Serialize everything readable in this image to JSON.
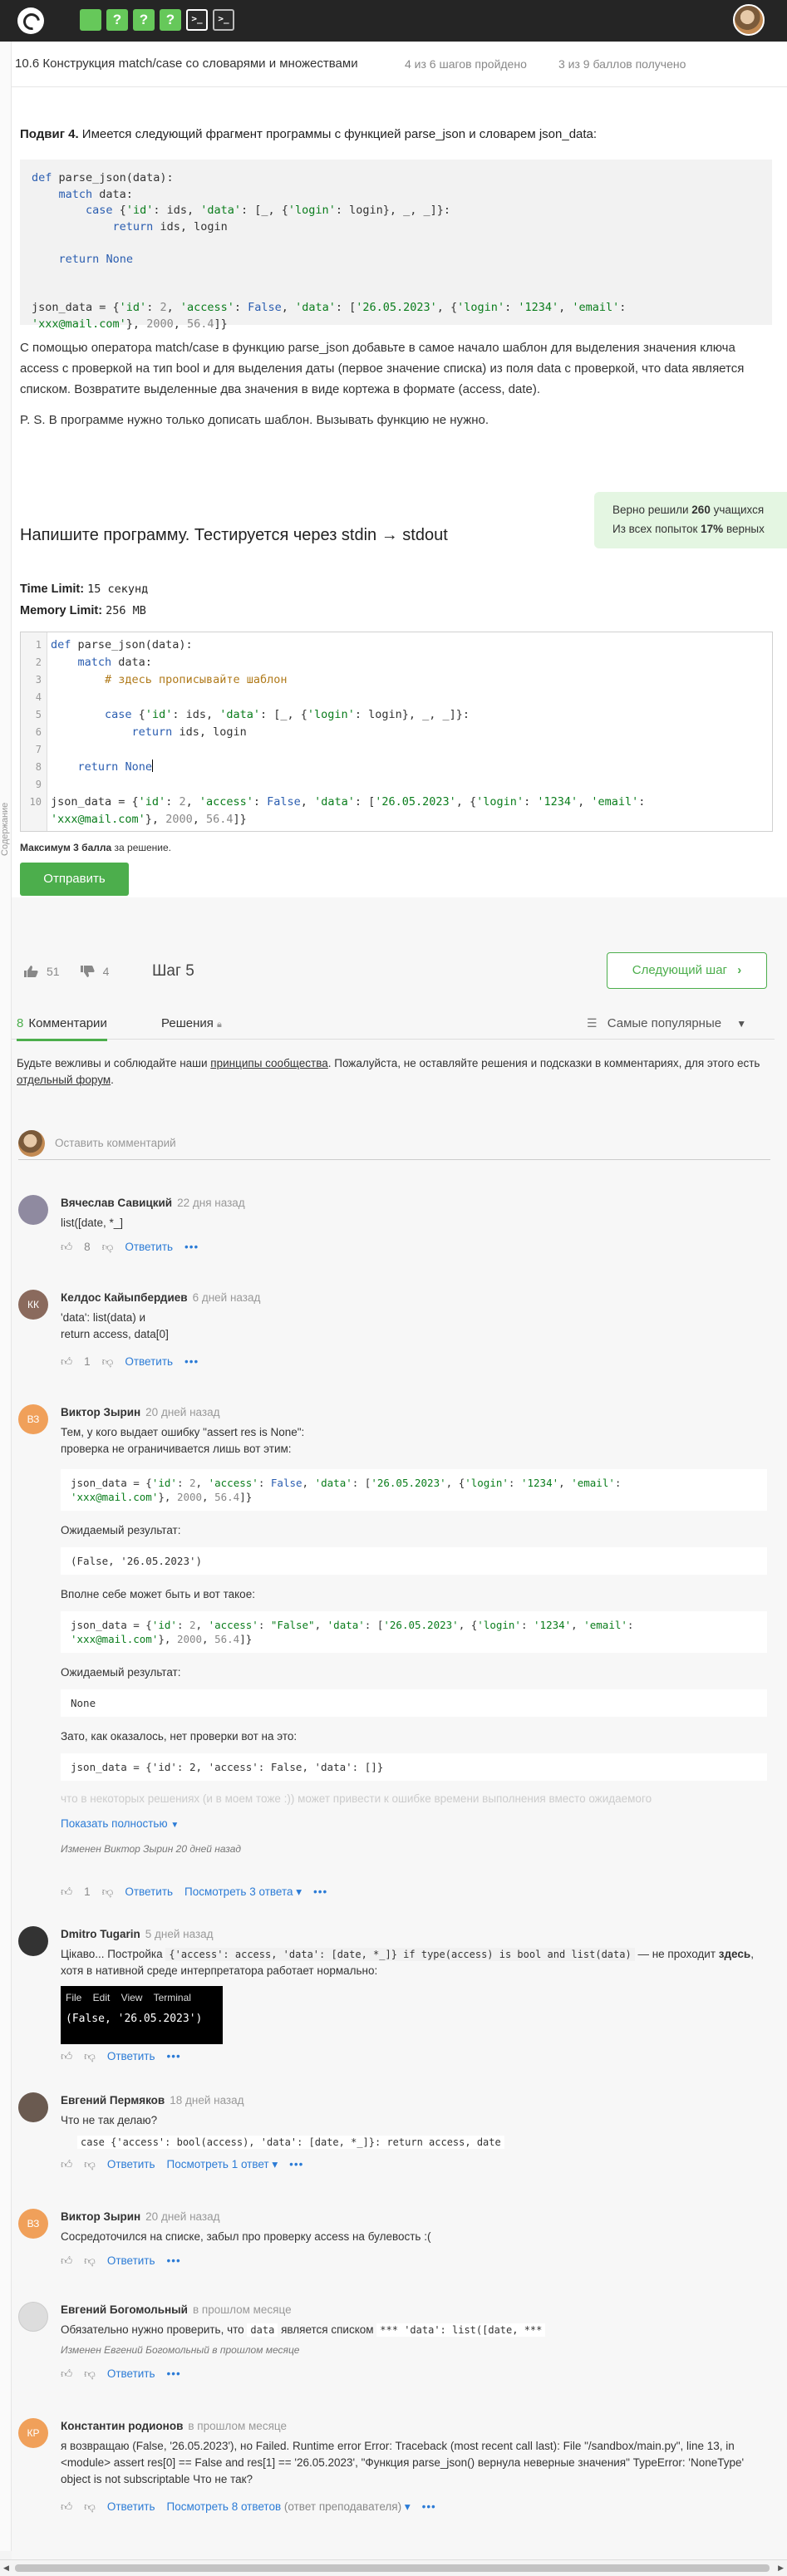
{
  "topbar": {
    "tiles": [
      "?",
      "?",
      "?"
    ],
    "term_tiles": [
      ">_",
      ">_"
    ]
  },
  "sidebar": {
    "label": "Содержание"
  },
  "lesson": {
    "title": "10.6 Конструкция match/case со словарями и множествами",
    "progress": "4 из 6 шагов пройдено",
    "score": "3 из 9 баллов  получено"
  },
  "task": {
    "intro_bold": "Подвиг 4.",
    "intro_rest": " Имеется следующий фрагмент программы с функцией parse_json и словарем json_data:",
    "text": "С помощью оператора match/case в функцию parse_json добавьте в самое начало шаблон для выделения значения ключа access с проверкой на тип bool и для выделения даты (первое значение списка) из поля data с проверкой, что data является списком. Возвратите выделенные два значения в виде кортежа в формате (access, date).",
    "ps": "P. S. В программе нужно только дописать шаблон. Вызывать функцию не нужно."
  },
  "solved": {
    "line1_prefix": "Верно решили ",
    "line1_count": "260",
    "line1_suffix": " учащихся",
    "line2_prefix": "Из всех попыток ",
    "line2_pct": "17%",
    "line2_suffix": " верных"
  },
  "program": {
    "title": "Напишите программу. Тестируется через stdin → stdout",
    "time_label": "Time Limit:",
    "time_value": "15 секунд",
    "memory_label": "Memory Limit:",
    "memory_value": "256 MB",
    "max_bold": "Максимум 3 балла",
    "max_rest": " за решение.",
    "submit_label": "Отправить"
  },
  "editor": {
    "line_numbers": [
      "1",
      "2",
      "3",
      "4",
      "5",
      "6",
      "7",
      "8",
      "9",
      "10"
    ]
  },
  "nav": {
    "likes": "51",
    "dislikes": "4",
    "step": "Шаг 5",
    "next_label": "Следующий шаг"
  },
  "tabs": {
    "comments_count": "8",
    "comments_label": "Комментарии",
    "solutions_label": "Решения",
    "sort_label": "Самые популярные"
  },
  "rules": {
    "p1": "Будьте вежливы и соблюдайте наши ",
    "link1": "принципы сообщества",
    "p2": ". Пожалуйста, не оставляйте решения и подсказки в комментариях, для этого есть ",
    "link2": "отдельный форум",
    "p3": "."
  },
  "comment_input": {
    "placeholder": "Оставить комментарий"
  },
  "comments": {
    "c1": {
      "author": "Вячеслав Савицкий",
      "time": "22 дня назад",
      "body": "list([date, *_]",
      "likes": "8",
      "reply": "Ответить"
    },
    "c2": {
      "initials": "КК",
      "author": "Келдос Кайыпбердиев",
      "time": "6 дней назад",
      "line1": "'data': list(data)  и",
      "line2": "return access, data[0]",
      "likes": "1",
      "reply": "Ответить"
    },
    "c3": {
      "initials": "ВЗ",
      "author": "Виктор Зырин",
      "time": "20 дней назад",
      "intro1": "Тем, у кого выдает ошибку \"assert res is None\":",
      "intro2": "проверка не ограничивается лишь вот этим:",
      "expected1_label": "Ожидаемый результат:",
      "expected1_value": "(False, '26.05.2023')",
      "also": "Вполне себе может быть и вот такое:",
      "expected2_label": "Ожидаемый результат:",
      "expected2_value": "None",
      "turns_out": "Зато, как оказалось, нет проверки вот на это:",
      "code3": "json_data = {'id': 2, 'access': False, 'data': []}",
      "faded": "что в некоторых решениях (и в моем тоже :)) может привести к ошибке времени выполнения вместо ожидаемого",
      "show_full": "Показать полностью",
      "edited": "Изменен Виктор Зырин 20 дней назад",
      "likes": "1",
      "reply": "Ответить",
      "replies": "Посмотреть 3 ответа"
    },
    "c4": {
      "author": "Dmitro Tugarin",
      "time": "5 дней назад",
      "text1": "Цікаво... Постройка ",
      "code1": "{'access': access, 'data': [date, *_]} if type(access) is bool and list(data)",
      "text2": " — не проходит ",
      "bold": "здесь",
      "text3": ", хотя в нативной среде интерпретатора работает нормально:",
      "term_menu": "File  Edit  View  Terminal",
      "term_out": "(False, '26.05.2023')",
      "reply": "Ответить"
    },
    "c5": {
      "author": "Евгений Пермяков",
      "time": "18 дней назад",
      "body": "Что не так делаю?",
      "code": "case {'access': bool(access), 'data': [date, *_]}: return access, date",
      "reply": "Ответить",
      "replies": "Посмотреть 1 ответ"
    },
    "c6": {
      "initials": "ВЗ",
      "author": "Виктор Зырин",
      "time": "20 дней назад",
      "body": "Сосредоточился на списке, забыл про проверку access на булевость :(",
      "reply": "Ответить"
    },
    "c7": {
      "author": "Евгений Богомольный",
      "time": "в прошлом месяце",
      "text1": "Обязательно нужно проверить, что ",
      "code1": "data",
      "text2": " является списком ",
      "code2": "*** 'data': list([date, ***",
      "edited": "Изменен Евгений Богомольный в прошлом месяце",
      "reply": "Ответить"
    },
    "c8": {
      "initials": "КР",
      "author": "Константин родионов",
      "time": "в прошлом месяце",
      "body": "я возвращаю (False, '26.05.2023'), но Failed. Runtime error Error: Traceback (most recent call last): File \"/sandbox/main.py\", line 13, in <module> assert res[0] == False and res[1] == '26.05.2023', \"Функция parse_json() вернула неверные значения\" TypeError: 'NoneType' object is not subscriptable    Что не так?",
      "reply": "Ответить",
      "replies": "Посмотреть 8 ответов",
      "replies_note": "(ответ преподавателя)"
    }
  },
  "colors": {
    "accent": "#4cae4c",
    "link": "#2b7bd6",
    "topbar": "#252525"
  }
}
